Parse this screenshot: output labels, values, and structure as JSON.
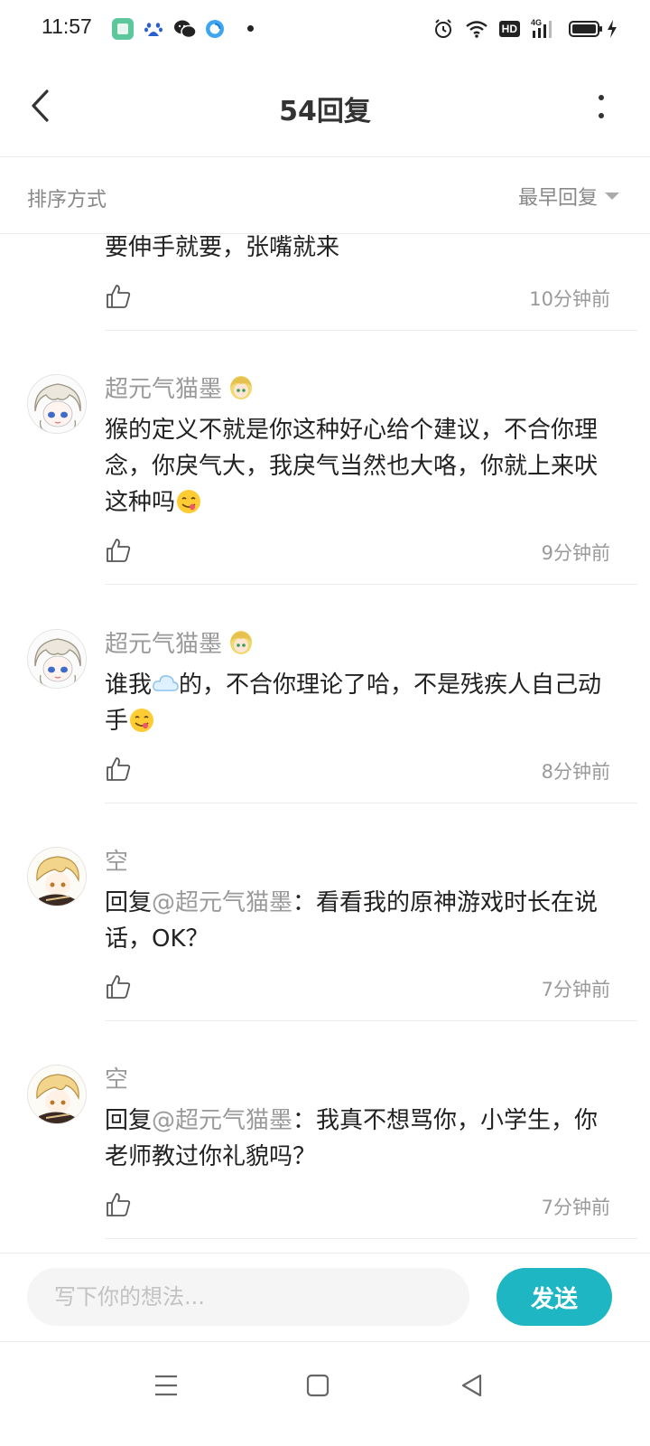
{
  "status_bar": {
    "time": "11:57",
    "notification_icons": [
      "reader-app-icon",
      "baidu-icon",
      "wechat-icon",
      "browser-icon"
    ],
    "system_icons": [
      "alarm-icon",
      "wifi-icon",
      "hd-icon",
      "signal-4g-icon",
      "battery-icon",
      "charging-icon"
    ],
    "hd_label": "HD",
    "network_label": "4G"
  },
  "header": {
    "title": "54回复"
  },
  "sort_bar": {
    "label": "排序方式",
    "selected": "最早回复"
  },
  "comments": [
    {
      "username": "",
      "text": "要伸手就要，张嘴就来",
      "time": "10分钟前"
    },
    {
      "username": "超元气猫墨",
      "badge_icon": "anime-face-badge-icon",
      "text": "猴的定义不就是你这种好心给个建议，不合你理念，你戾气大，我戾气当然也大咯，你就上来吠这种吗",
      "trailing_emoji": "yum-emoji-icon",
      "time": "9分钟前"
    },
    {
      "username": "超元气猫墨",
      "badge_icon": "anime-face-badge-icon",
      "text_before": "谁我",
      "inline_emoji": "cloud-emoji-icon",
      "text_after": "的，不合你理论了哈，不是残疾人自己动手",
      "trailing_emoji": "yum-emoji-icon",
      "time": "8分钟前"
    },
    {
      "username": "空",
      "reply_prefix": "回复",
      "mention": "@超元气猫墨",
      "text": "：看看我的原神游戏时长在说话，OK？",
      "time": "7分钟前"
    },
    {
      "username": "空",
      "reply_prefix": "回复",
      "mention": "@超元气猫墨",
      "text": "：我真不想骂你，小学生，你老师教过你礼貌吗？",
      "time": "7分钟前"
    }
  ],
  "input_bar": {
    "placeholder": "写下你的想法...",
    "send_label": "发送"
  },
  "colors": {
    "accent": "#1fb6c3",
    "muted_text": "#9a9a9a",
    "body_text": "#222222",
    "divider": "#ececec"
  }
}
